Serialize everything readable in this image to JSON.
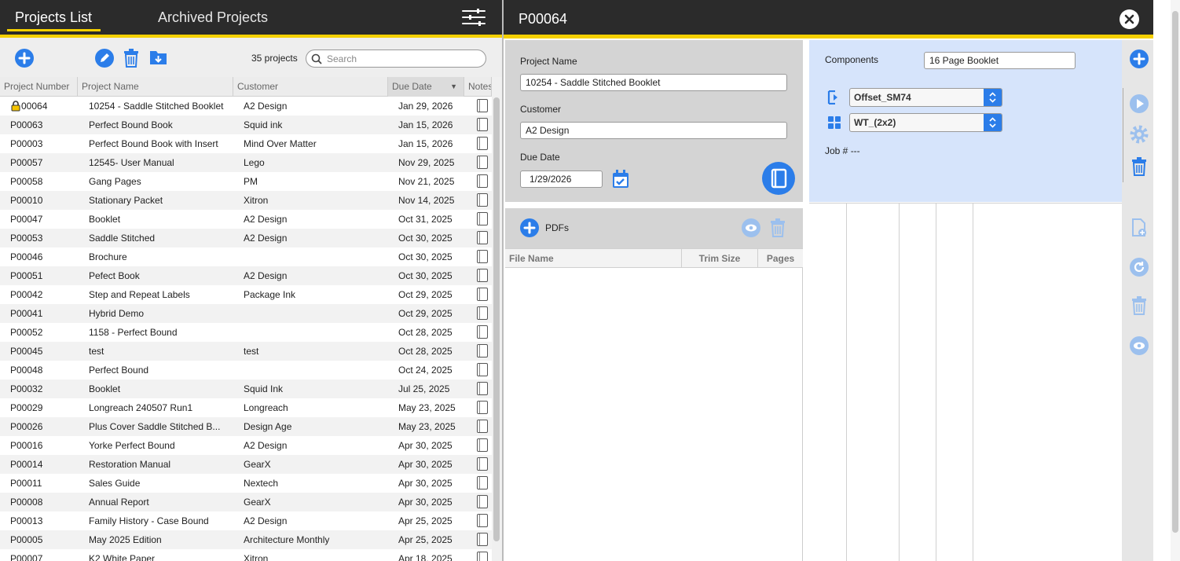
{
  "left_header": {
    "tab_projects": "Projects List",
    "tab_archived": "Archived Projects"
  },
  "toolbar": {
    "count": "35 projects",
    "search_placeholder": "Search"
  },
  "columns": [
    "Project Number",
    "Project Name",
    "Customer",
    "Due Date",
    "Notes"
  ],
  "rows": [
    {
      "num": "P00064",
      "name": "10254 - Saddle Stitched Booklet",
      "cust": "A2 Design",
      "due": "Jan 29, 2026",
      "locked": true
    },
    {
      "num": "P00063",
      "name": "Perfect Bound Book",
      "cust": "Squid ink",
      "due": "Jan 15, 2026"
    },
    {
      "num": "P00003",
      "name": "Perfect Bound Book with Insert",
      "cust": "Mind Over Matter",
      "due": "Jan 15, 2026"
    },
    {
      "num": "P00057",
      "name": "12545- User Manual",
      "cust": "Lego",
      "due": "Nov 29, 2025"
    },
    {
      "num": "P00058",
      "name": "Gang Pages",
      "cust": "PM",
      "due": "Nov 21, 2025"
    },
    {
      "num": "P00010",
      "name": "Stationary Packet",
      "cust": "Xitron",
      "due": "Nov 14, 2025"
    },
    {
      "num": "P00047",
      "name": "Booklet",
      "cust": "A2 Design",
      "due": "Oct 31, 2025"
    },
    {
      "num": "P00053",
      "name": "Saddle Stitched",
      "cust": "A2 Design",
      "due": "Oct 30, 2025"
    },
    {
      "num": "P00046",
      "name": "Brochure",
      "cust": "",
      "due": "Oct 30, 2025"
    },
    {
      "num": "P00051",
      "name": "Pefect Book",
      "cust": "A2 Design",
      "due": "Oct 30, 2025"
    },
    {
      "num": "P00042",
      "name": "Step and Repeat Labels",
      "cust": "Package Ink",
      "due": "Oct 29, 2025"
    },
    {
      "num": "P00041",
      "name": "Hybrid Demo",
      "cust": "",
      "due": "Oct 29, 2025"
    },
    {
      "num": "P00052",
      "name": "1158 - Perfect Bound",
      "cust": "",
      "due": "Oct 28, 2025"
    },
    {
      "num": "P00045",
      "name": "test",
      "cust": "test",
      "due": "Oct 28, 2025"
    },
    {
      "num": "P00048",
      "name": "Perfect Bound",
      "cust": "",
      "due": "Oct 24, 2025"
    },
    {
      "num": "P00032",
      "name": "Booklet",
      "cust": "Squid Ink",
      "due": "Jul 25, 2025"
    },
    {
      "num": "P00029",
      "name": "Longreach 240507 Run1",
      "cust": "Longreach",
      "due": "May 23, 2025"
    },
    {
      "num": "P00026",
      "name": "Plus Cover Saddle Stitched B...",
      "cust": "Design Age",
      "due": "May 23, 2025"
    },
    {
      "num": "P00016",
      "name": "Yorke Perfect Bound",
      "cust": "A2 Design",
      "due": "Apr 30, 2025"
    },
    {
      "num": "P00014",
      "name": "Restoration Manual",
      "cust": "GearX",
      "due": "Apr 30, 2025"
    },
    {
      "num": "P00011",
      "name": "Sales Guide",
      "cust": "Nextech",
      "due": "Apr 30, 2025"
    },
    {
      "num": "P00008",
      "name": "Annual Report",
      "cust": "GearX",
      "due": "Apr 30, 2025"
    },
    {
      "num": "P00013",
      "name": "Family History - Case Bound",
      "cust": "A2 Design",
      "due": "Apr 25, 2025"
    },
    {
      "num": "P00005",
      "name": "May 2025 Edition",
      "cust": "Architecture Monthly",
      "due": "Apr 25, 2025"
    },
    {
      "num": "P00007",
      "name": "K2 White Paper",
      "cust": "Xitron",
      "due": "Apr 18, 2025"
    }
  ],
  "detail": {
    "title": "P00064",
    "project_name_label": "Project Name",
    "project_name": "10254 - Saddle Stitched Booklet",
    "customer_label": "Customer",
    "customer": "A2 Design",
    "due_label": "Due Date",
    "due": "1/29/2026"
  },
  "pdfs": {
    "label": "PDFs",
    "columns": [
      "File Name",
      "Trim Size",
      "Pages"
    ]
  },
  "components": {
    "label": "Components",
    "value": "16 Page Booklet",
    "device": "Offset_SM74",
    "imposition": "WT_(2x2)",
    "job": "Job # ---"
  },
  "colors": {
    "accent": "#2b7de9",
    "header": "#2b2b2b",
    "highlight": "#f5d000",
    "component_bg": "#d6e4fb"
  }
}
